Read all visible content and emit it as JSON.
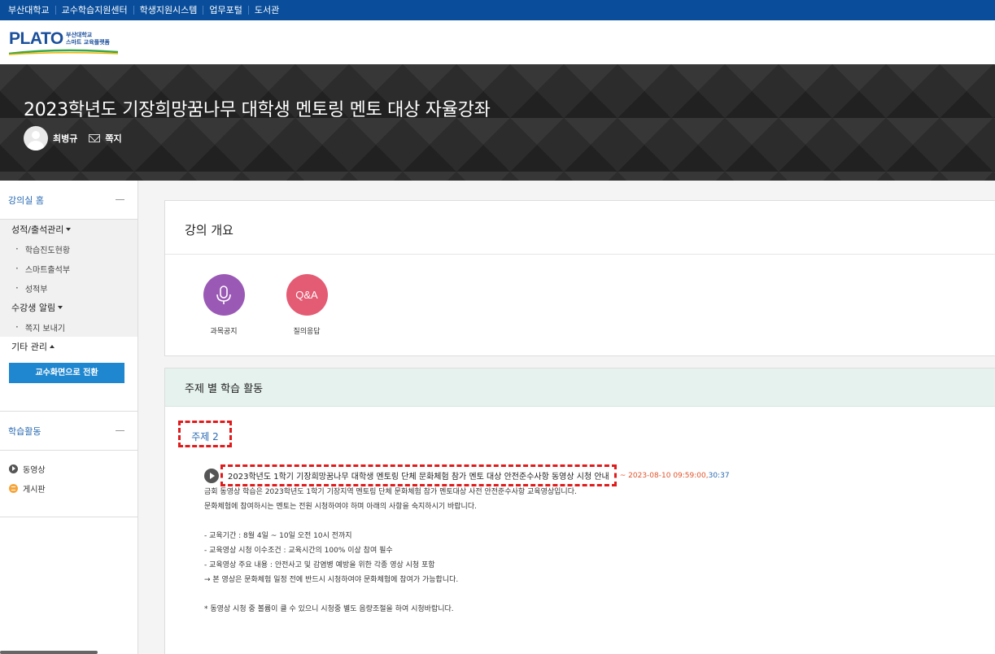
{
  "topnav": [
    "부산대학교",
    "교수학습지원센터",
    "학생지원시스템",
    "업무포털",
    "도서관"
  ],
  "logo": {
    "main": "PLATO",
    "sub1": "부산대학교",
    "sub2": "스마트 교육플랫폼"
  },
  "header": {
    "course_title": "2023학년도 기장희망꿈나무 대학생 멘토링 멘토 대상 자율강좌",
    "professor": "최병규",
    "message_label": "쪽지"
  },
  "sidebar": {
    "home_label": "강의실 홈",
    "grades": {
      "title": "성적/출석관리",
      "items": [
        "학습진도현황",
        "스마트출석부",
        "성적부"
      ]
    },
    "notice": {
      "title": "수강생 알림",
      "items": [
        "쪽지 보내기"
      ]
    },
    "etc_title": "기타 관리",
    "switch_button": "교수화면으로 전환",
    "activities_label": "학습활동",
    "activities": [
      "동영상",
      "게시판"
    ]
  },
  "overview": {
    "title": "강의 개요",
    "buttons": [
      {
        "label": "과목공지",
        "icon": "microphone-icon"
      },
      {
        "label": "질의응답",
        "text": "Q&A"
      }
    ]
  },
  "topics": {
    "title": "주제 별 학습 활동",
    "topic_name": "주제 2",
    "activity": {
      "title": "2023학년도 1학기 기장희망꿈나무 대학생 멘토링 단체 문화체험 참가 멘토 대상 안전준수사항 동영상 시청 안내",
      "due": "~ 2023-08-10 09:59:00,",
      "duration": "30:37"
    },
    "description": [
      "금회 동영상 학습은 2023학년도 1학기 기장지역 멘토링 단체 문화체험 참가 멘토대상 사전 안전준수사항 교육영상입니다.",
      "문화체험에 참여하시는 멘토는 전원 시청하여야 하며 아래의 사항을 숙지하시기 바랍니다.",
      "",
      "- 교육기간 : 8월 4일 ~ 10일 오전 10시 전까지",
      "- 교육영상 시청 이수조건 : 교육시간의 100% 이상 참여 필수",
      "- 교육영상 주요 내용 : 안전사고 및 감염병 예방을 위한 각종 영상 시청 포함",
      "→ 본 영상은 문화체험 일정 전에 반드시 시청하여야 문화체험에 참여가 가능합니다.",
      "",
      "* 동영상 시청 중 볼륨이 클 수 있으니 시청중 별도 음량조절을 하여 시청바랍니다."
    ]
  }
}
